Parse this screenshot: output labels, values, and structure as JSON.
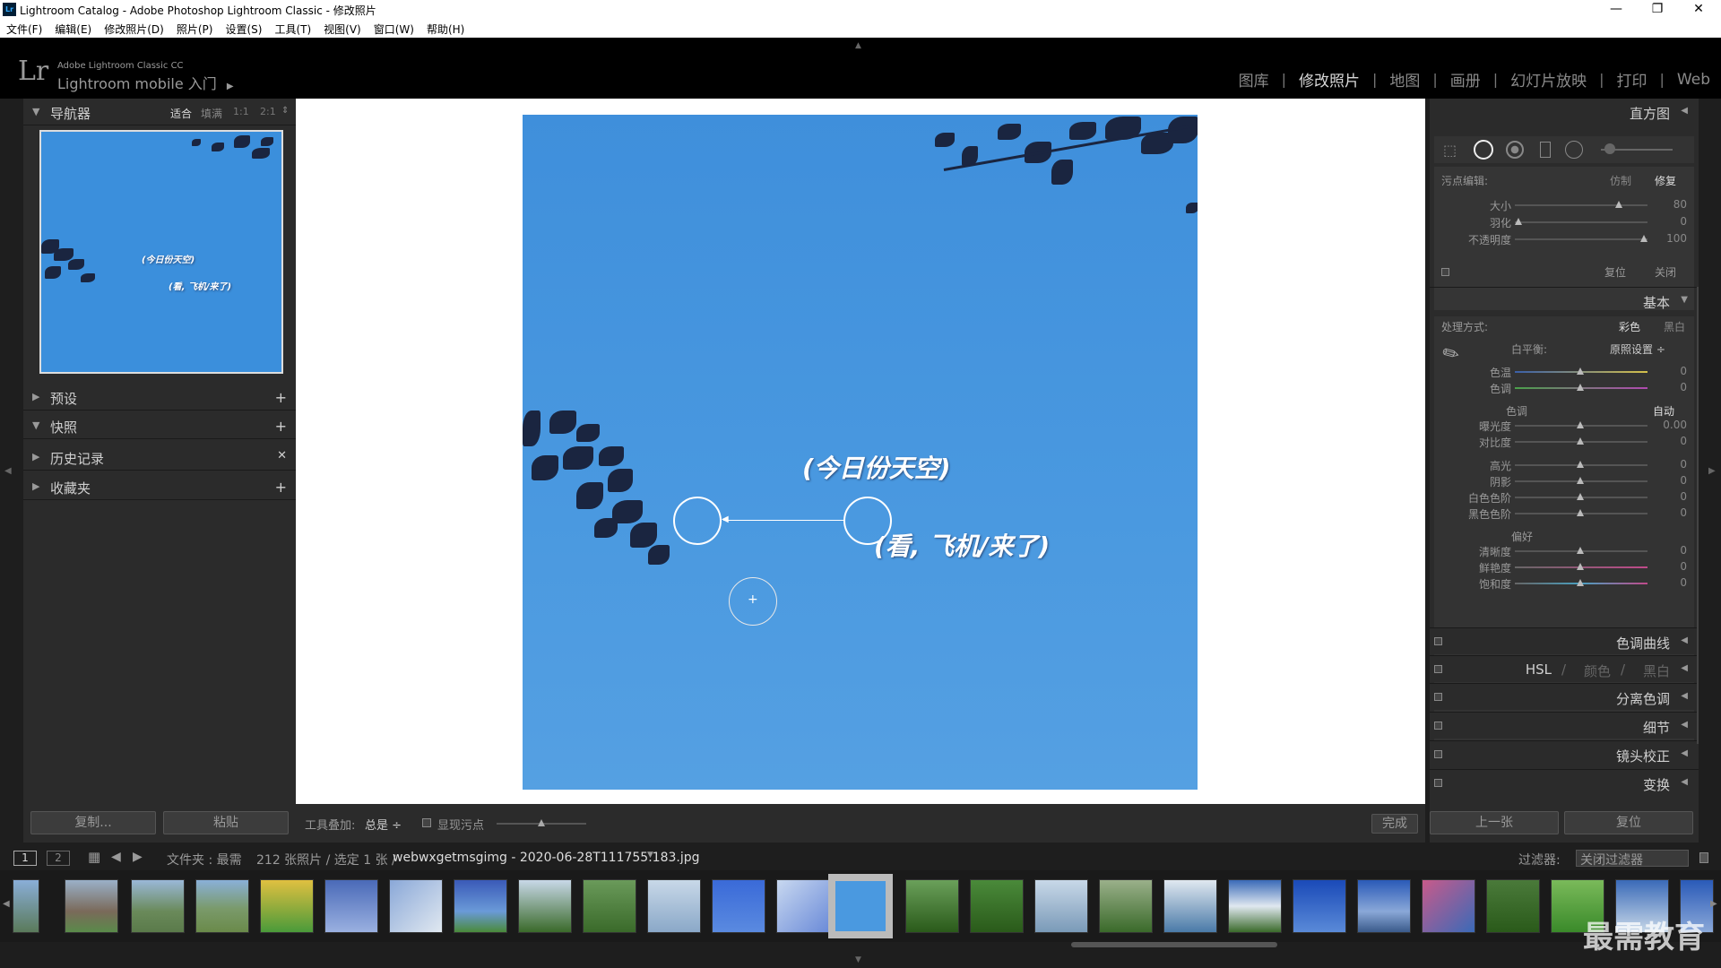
{
  "window": {
    "title": "Lightroom Catalog - Adobe Photoshop Lightroom Classic - 修改照片",
    "icon_label": "Lr",
    "controls": [
      "minimize-icon",
      "restore-icon",
      "close-icon"
    ]
  },
  "menu": [
    "文件(F)",
    "编辑(E)",
    "修改照片(D)",
    "照片(P)",
    "设置(S)",
    "工具(T)",
    "视图(V)",
    "窗口(W)",
    "帮助(H)"
  ],
  "identity": {
    "logo": "Lr",
    "product": "Adobe Lightroom Classic CC",
    "mobile": "Lightroom mobile 入门",
    "modules": [
      "图库",
      "修改照片",
      "地图",
      "画册",
      "幻灯片放映",
      "打印",
      "Web"
    ],
    "active_module": "修改照片"
  },
  "left": {
    "navigator": {
      "title": "导航器",
      "zoom": [
        "适合",
        "填满",
        "1:1",
        "2:1"
      ],
      "thumb_caption1": "(今日份天空)",
      "thumb_caption2": "(看, 飞机/来了)"
    },
    "presets": "预设",
    "snapshots": "快照",
    "history": "历史记录",
    "collections": "收藏夹",
    "copy_btn": "复制...",
    "paste_btn": "粘贴"
  },
  "photo": {
    "caption1": "(今日份天空)",
    "caption2": "(看, 飞机/来了)"
  },
  "toolbar": {
    "overlay_label": "工具叠加:",
    "overlay_value": "总是",
    "visualize_spots": "显现污点",
    "done": "完成"
  },
  "right": {
    "histogram": "直方图",
    "spot": {
      "label": "污点编辑:",
      "clone": "仿制",
      "heal": "修复",
      "size_label": "大小",
      "size": "80",
      "size_level": 0.8,
      "feather_label": "羽化",
      "feather": "0",
      "feather_level": 0.0,
      "opacity_label": "不透明度",
      "opacity": "100",
      "opacity_level": 1.0,
      "reset": "复位",
      "close": "关闭"
    },
    "basic": {
      "title": "基本",
      "treatment_label": "处理方式:",
      "color": "彩色",
      "bw": "黑白",
      "wb_label": "白平衡:",
      "wb_value": "原照设置 ÷",
      "temp_label": "色温",
      "temp": "0",
      "tint_label": "色调",
      "tint": "0",
      "tone_label": "色调",
      "auto": "自动",
      "exposure_label": "曝光度",
      "exposure": "0.00",
      "contrast_label": "对比度",
      "contrast": "0",
      "highlights_label": "高光",
      "highlights": "0",
      "shadows_label": "阴影",
      "shadows": "0",
      "whites_label": "白色色阶",
      "whites": "0",
      "blacks_label": "黑色色阶",
      "blacks": "0",
      "presence_label": "偏好",
      "clarity_label": "清晰度",
      "clarity": "0",
      "vibrance_label": "鲜艳度",
      "vibrance": "0",
      "saturation_label": "饱和度",
      "saturation": "0"
    },
    "tone_curve": "色调曲线",
    "hsl": "HSL",
    "hsl_color": "颜色",
    "hsl_bw": "黑白",
    "split_toning": "分离色调",
    "detail": "细节",
    "lens": "镜头校正",
    "transform": "变换",
    "prev_btn": "上一张",
    "reset_btn": "复位"
  },
  "filmstrip": {
    "page1": "1",
    "page2": "2",
    "source": "文件夹 : 最需",
    "count": "212 张照片 / 选定 1 张 /",
    "filename": "webwxgetmsgimg - 2020-06-28T111755.183.jpg",
    "filter_label": "过滤器:",
    "filter_value": "关闭过滤器"
  },
  "watermark": "最需教育",
  "colors": {
    "accent_sky": "#4a99e0",
    "panel": "#2b2b2b",
    "identity": "#000000"
  }
}
